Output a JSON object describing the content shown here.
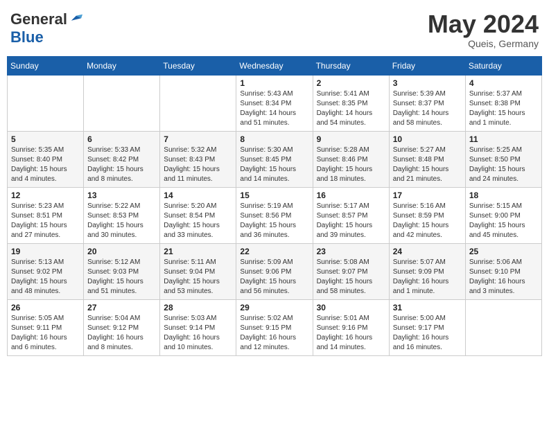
{
  "header": {
    "logo_general": "General",
    "logo_blue": "Blue",
    "month_year": "May 2024",
    "location": "Queis, Germany"
  },
  "days_of_week": [
    "Sunday",
    "Monday",
    "Tuesday",
    "Wednesday",
    "Thursday",
    "Friday",
    "Saturday"
  ],
  "weeks": [
    [
      {
        "day": "",
        "info": ""
      },
      {
        "day": "",
        "info": ""
      },
      {
        "day": "",
        "info": ""
      },
      {
        "day": "1",
        "info": "Sunrise: 5:43 AM\nSunset: 8:34 PM\nDaylight: 14 hours\nand 51 minutes."
      },
      {
        "day": "2",
        "info": "Sunrise: 5:41 AM\nSunset: 8:35 PM\nDaylight: 14 hours\nand 54 minutes."
      },
      {
        "day": "3",
        "info": "Sunrise: 5:39 AM\nSunset: 8:37 PM\nDaylight: 14 hours\nand 58 minutes."
      },
      {
        "day": "4",
        "info": "Sunrise: 5:37 AM\nSunset: 8:38 PM\nDaylight: 15 hours\nand 1 minute."
      }
    ],
    [
      {
        "day": "5",
        "info": "Sunrise: 5:35 AM\nSunset: 8:40 PM\nDaylight: 15 hours\nand 4 minutes."
      },
      {
        "day": "6",
        "info": "Sunrise: 5:33 AM\nSunset: 8:42 PM\nDaylight: 15 hours\nand 8 minutes."
      },
      {
        "day": "7",
        "info": "Sunrise: 5:32 AM\nSunset: 8:43 PM\nDaylight: 15 hours\nand 11 minutes."
      },
      {
        "day": "8",
        "info": "Sunrise: 5:30 AM\nSunset: 8:45 PM\nDaylight: 15 hours\nand 14 minutes."
      },
      {
        "day": "9",
        "info": "Sunrise: 5:28 AM\nSunset: 8:46 PM\nDaylight: 15 hours\nand 18 minutes."
      },
      {
        "day": "10",
        "info": "Sunrise: 5:27 AM\nSunset: 8:48 PM\nDaylight: 15 hours\nand 21 minutes."
      },
      {
        "day": "11",
        "info": "Sunrise: 5:25 AM\nSunset: 8:50 PM\nDaylight: 15 hours\nand 24 minutes."
      }
    ],
    [
      {
        "day": "12",
        "info": "Sunrise: 5:23 AM\nSunset: 8:51 PM\nDaylight: 15 hours\nand 27 minutes."
      },
      {
        "day": "13",
        "info": "Sunrise: 5:22 AM\nSunset: 8:53 PM\nDaylight: 15 hours\nand 30 minutes."
      },
      {
        "day": "14",
        "info": "Sunrise: 5:20 AM\nSunset: 8:54 PM\nDaylight: 15 hours\nand 33 minutes."
      },
      {
        "day": "15",
        "info": "Sunrise: 5:19 AM\nSunset: 8:56 PM\nDaylight: 15 hours\nand 36 minutes."
      },
      {
        "day": "16",
        "info": "Sunrise: 5:17 AM\nSunset: 8:57 PM\nDaylight: 15 hours\nand 39 minutes."
      },
      {
        "day": "17",
        "info": "Sunrise: 5:16 AM\nSunset: 8:59 PM\nDaylight: 15 hours\nand 42 minutes."
      },
      {
        "day": "18",
        "info": "Sunrise: 5:15 AM\nSunset: 9:00 PM\nDaylight: 15 hours\nand 45 minutes."
      }
    ],
    [
      {
        "day": "19",
        "info": "Sunrise: 5:13 AM\nSunset: 9:02 PM\nDaylight: 15 hours\nand 48 minutes."
      },
      {
        "day": "20",
        "info": "Sunrise: 5:12 AM\nSunset: 9:03 PM\nDaylight: 15 hours\nand 51 minutes."
      },
      {
        "day": "21",
        "info": "Sunrise: 5:11 AM\nSunset: 9:04 PM\nDaylight: 15 hours\nand 53 minutes."
      },
      {
        "day": "22",
        "info": "Sunrise: 5:09 AM\nSunset: 9:06 PM\nDaylight: 15 hours\nand 56 minutes."
      },
      {
        "day": "23",
        "info": "Sunrise: 5:08 AM\nSunset: 9:07 PM\nDaylight: 15 hours\nand 58 minutes."
      },
      {
        "day": "24",
        "info": "Sunrise: 5:07 AM\nSunset: 9:09 PM\nDaylight: 16 hours\nand 1 minute."
      },
      {
        "day": "25",
        "info": "Sunrise: 5:06 AM\nSunset: 9:10 PM\nDaylight: 16 hours\nand 3 minutes."
      }
    ],
    [
      {
        "day": "26",
        "info": "Sunrise: 5:05 AM\nSunset: 9:11 PM\nDaylight: 16 hours\nand 6 minutes."
      },
      {
        "day": "27",
        "info": "Sunrise: 5:04 AM\nSunset: 9:12 PM\nDaylight: 16 hours\nand 8 minutes."
      },
      {
        "day": "28",
        "info": "Sunrise: 5:03 AM\nSunset: 9:14 PM\nDaylight: 16 hours\nand 10 minutes."
      },
      {
        "day": "29",
        "info": "Sunrise: 5:02 AM\nSunset: 9:15 PM\nDaylight: 16 hours\nand 12 minutes."
      },
      {
        "day": "30",
        "info": "Sunrise: 5:01 AM\nSunset: 9:16 PM\nDaylight: 16 hours\nand 14 minutes."
      },
      {
        "day": "31",
        "info": "Sunrise: 5:00 AM\nSunset: 9:17 PM\nDaylight: 16 hours\nand 16 minutes."
      },
      {
        "day": "",
        "info": ""
      }
    ]
  ]
}
